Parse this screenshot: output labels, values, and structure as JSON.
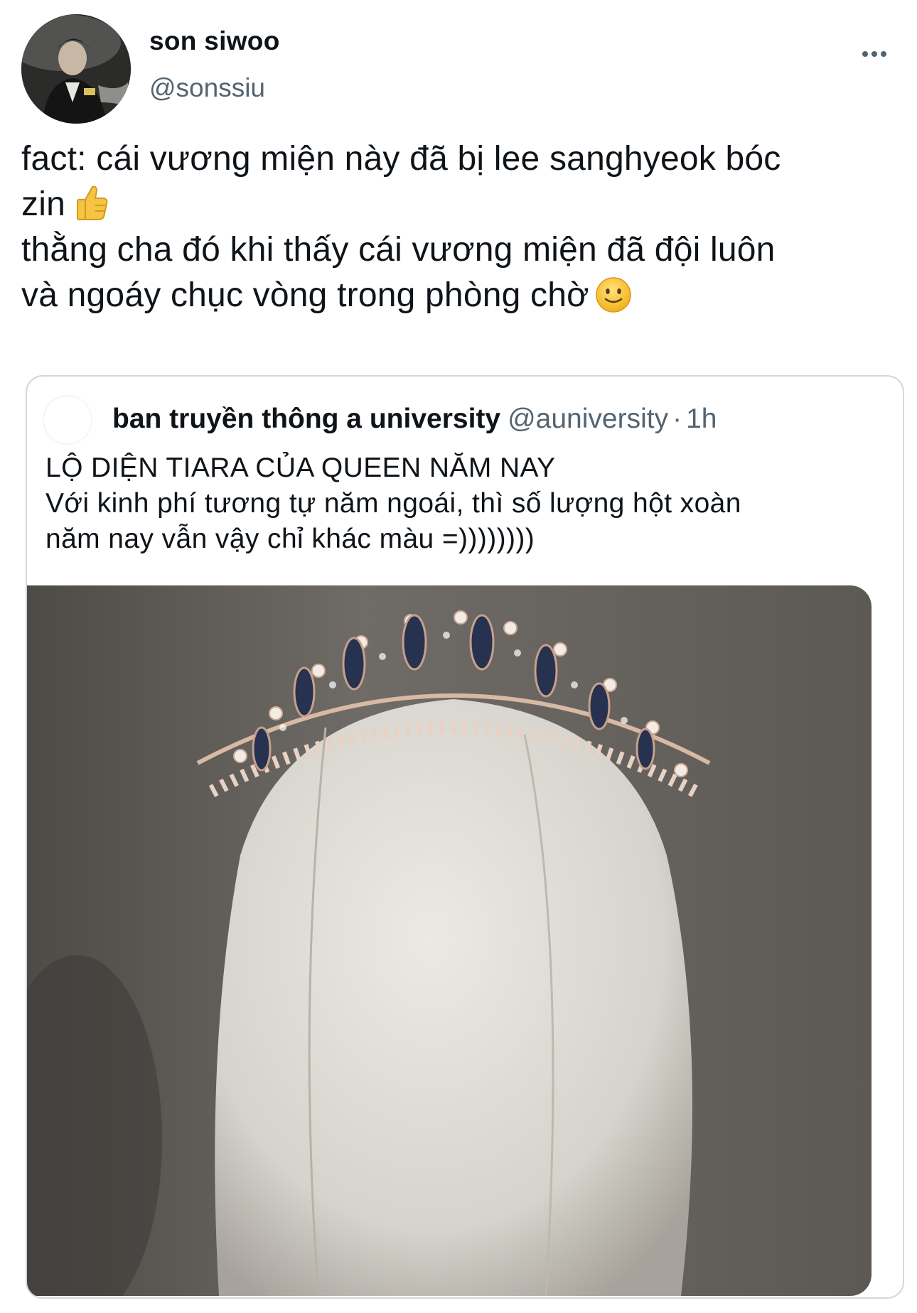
{
  "author": {
    "display_name": "son siwoo",
    "handle": "@sonssiu",
    "avatar_icon": "profile-photo"
  },
  "menu": {
    "icon": "more-dots-icon"
  },
  "tweet": {
    "lines": [
      "fact: cái vương miện này đã bị lee sanghyeok bóc",
      "zin",
      "thằng cha đó khi thấy cái vương miện đã đội luôn",
      "và ngoáy chục vòng trong phòng chờ"
    ],
    "emojis": [
      "thumbs-up",
      "slightly-smiling-face"
    ]
  },
  "quoted_tweet": {
    "display_name": "ban truyền thông a university",
    "handle": "@auniversity",
    "separator": "·",
    "time": "1h",
    "lines": [
      "LỘ DIỆN TIARA CỦA QUEEN NĂM NAY",
      "Với kinh phí tương tự năm ngoái, thì số lượng hột xoàn",
      "năm nay vẫn vậy chỉ khác màu =))))))))"
    ],
    "image_subject": "tiara-on-mannequin-head"
  },
  "colors": {
    "text": "#0f1419",
    "secondary": "#536471",
    "border": "#cfd9de",
    "background": "#ffffff"
  }
}
